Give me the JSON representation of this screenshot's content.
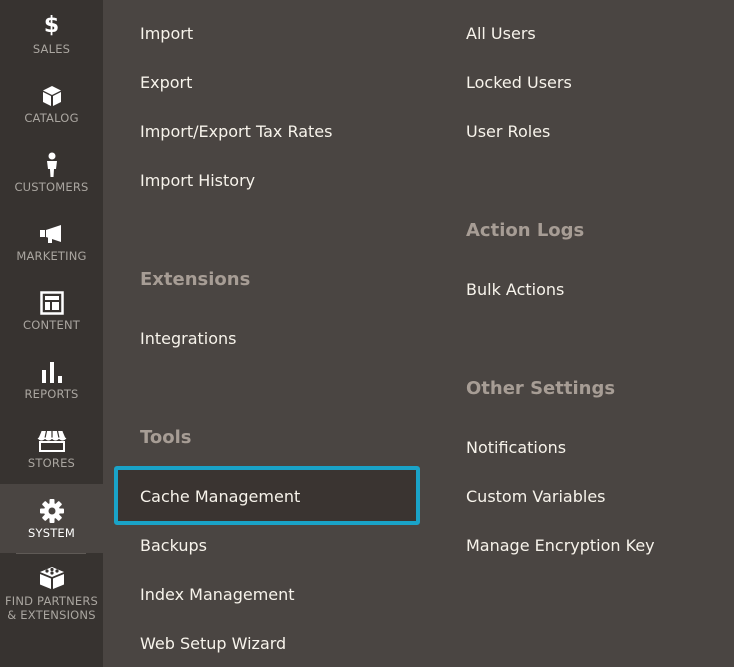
{
  "nav": {
    "items": [
      {
        "id": "sales",
        "label": "SALES",
        "icon": "dollar-icon"
      },
      {
        "id": "catalog",
        "label": "CATALOG",
        "icon": "box-icon"
      },
      {
        "id": "customers",
        "label": "CUSTOMERS",
        "icon": "person-icon"
      },
      {
        "id": "marketing",
        "label": "MARKETING",
        "icon": "megaphone-icon"
      },
      {
        "id": "content",
        "label": "CONTENT",
        "icon": "layout-icon"
      },
      {
        "id": "reports",
        "label": "REPORTS",
        "icon": "bar-chart-icon"
      },
      {
        "id": "stores",
        "label": "STORES",
        "icon": "storefront-icon"
      },
      {
        "id": "system",
        "label": "SYSTEM",
        "icon": "gear-icon",
        "active": true
      },
      {
        "id": "partners",
        "label": "FIND PARTNERS\n& EXTENSIONS",
        "icon": "blocks-icon"
      }
    ]
  },
  "menu": {
    "col1": {
      "import": "Import",
      "export": "Export",
      "tax_rates": "Import/Export Tax Rates",
      "import_history": "Import History",
      "extensions_heading": "Extensions",
      "integrations": "Integrations",
      "tools_heading": "Tools",
      "cache_management": "Cache Management",
      "backups": "Backups",
      "index_management": "Index Management",
      "web_setup_wizard": "Web Setup Wizard"
    },
    "col2": {
      "all_users": "All Users",
      "locked_users": "Locked Users",
      "user_roles": "User Roles",
      "action_logs_heading": "Action Logs",
      "bulk_actions": "Bulk Actions",
      "other_settings_heading": "Other Settings",
      "notifications": "Notifications",
      "custom_variables": "Custom Variables",
      "encryption_key": "Manage Encryption Key"
    }
  },
  "colors": {
    "rail_bg": "#373330",
    "panel_bg": "#4a4542",
    "highlight_border": "#1aa3c8",
    "link_text": "#f7f3eb",
    "heading_text": "#a79d95"
  }
}
